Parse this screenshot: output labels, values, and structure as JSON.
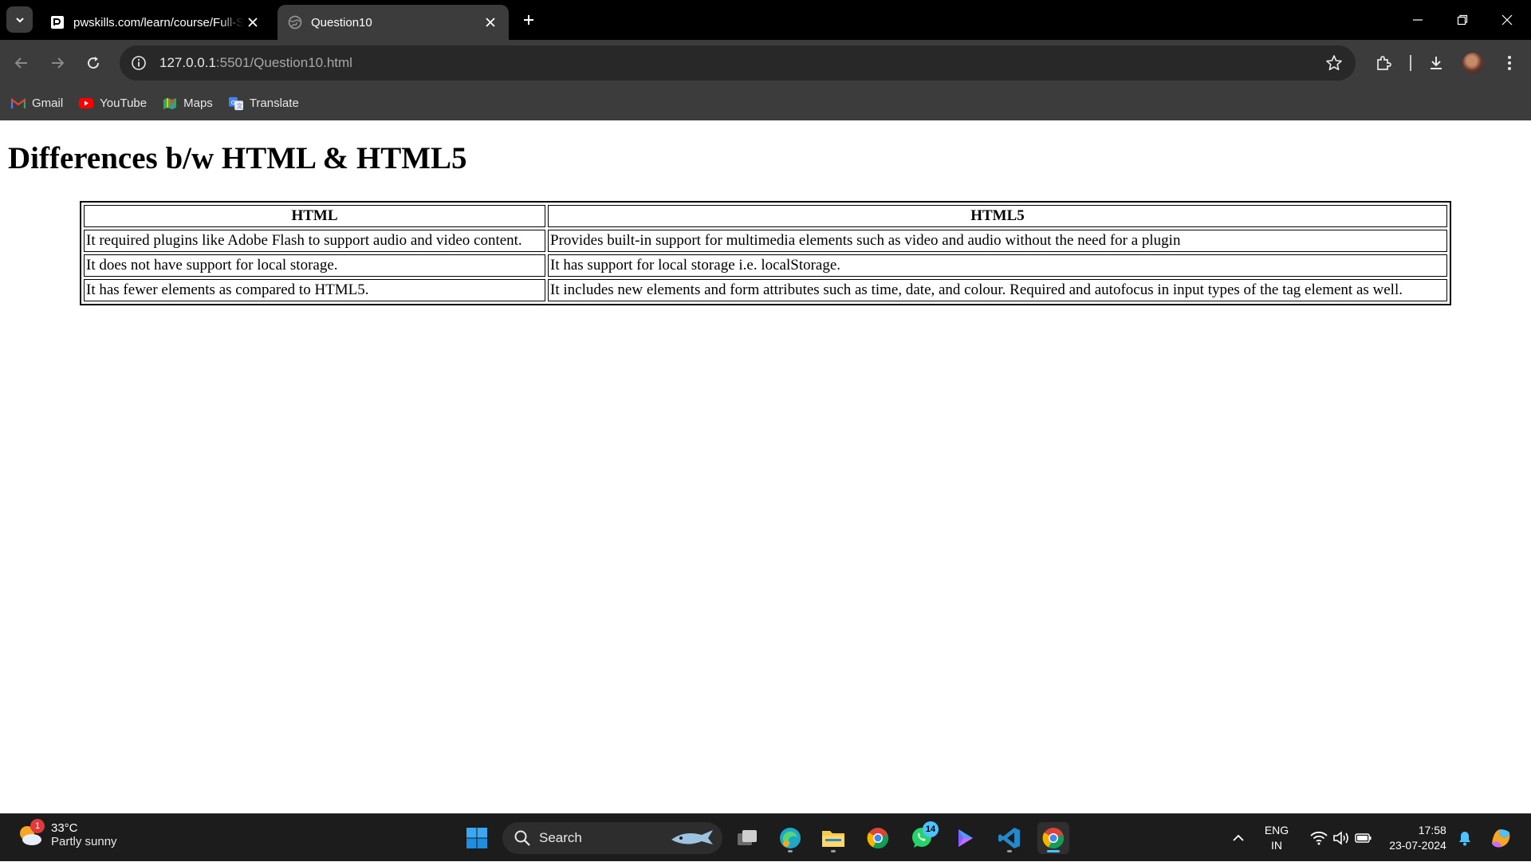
{
  "browser": {
    "tabs": [
      {
        "title": "pwskills.com/learn/course/Full-Stack",
        "active": false
      },
      {
        "title": "Question10",
        "active": true
      }
    ],
    "address": {
      "host": "127.0.0.1",
      "rest": ":5501/Question10.html"
    },
    "bookmarks": [
      {
        "label": "Gmail",
        "icon": "gmail-icon"
      },
      {
        "label": "YouTube",
        "icon": "youtube-icon"
      },
      {
        "label": "Maps",
        "icon": "maps-icon"
      },
      {
        "label": "Translate",
        "icon": "translate-icon"
      }
    ]
  },
  "page": {
    "heading": "Differences b/w HTML & HTML5",
    "table": {
      "headers": [
        "HTML",
        "HTML5"
      ],
      "rows": [
        [
          "It required plugins like Adobe Flash to support audio and video content.",
          "Provides built-in support for multimedia elements such as video and audio without the need for a plugin"
        ],
        [
          "It does not have support for local storage.",
          "It has support for local storage i.e. localStorage."
        ],
        [
          "It has fewer elements as compared to HTML5.",
          "It includes new elements and form attributes such as time, date, and colour. Required and autofocus in input types of the tag element as well."
        ]
      ]
    }
  },
  "taskbar": {
    "weather": {
      "temp": "33°C",
      "condition": "Partly sunny",
      "badge": "1"
    },
    "search_label": "Search",
    "whatsapp_badge": "14",
    "language": {
      "line1": "ENG",
      "line2": "IN"
    },
    "clock": {
      "time": "17:58",
      "date": "23-07-2024"
    }
  },
  "colors": {
    "accent": "#4cc2ff",
    "toolbar": "#3c3c3c",
    "tabstrip": "#000000",
    "taskbar": "#1c1c1c"
  }
}
